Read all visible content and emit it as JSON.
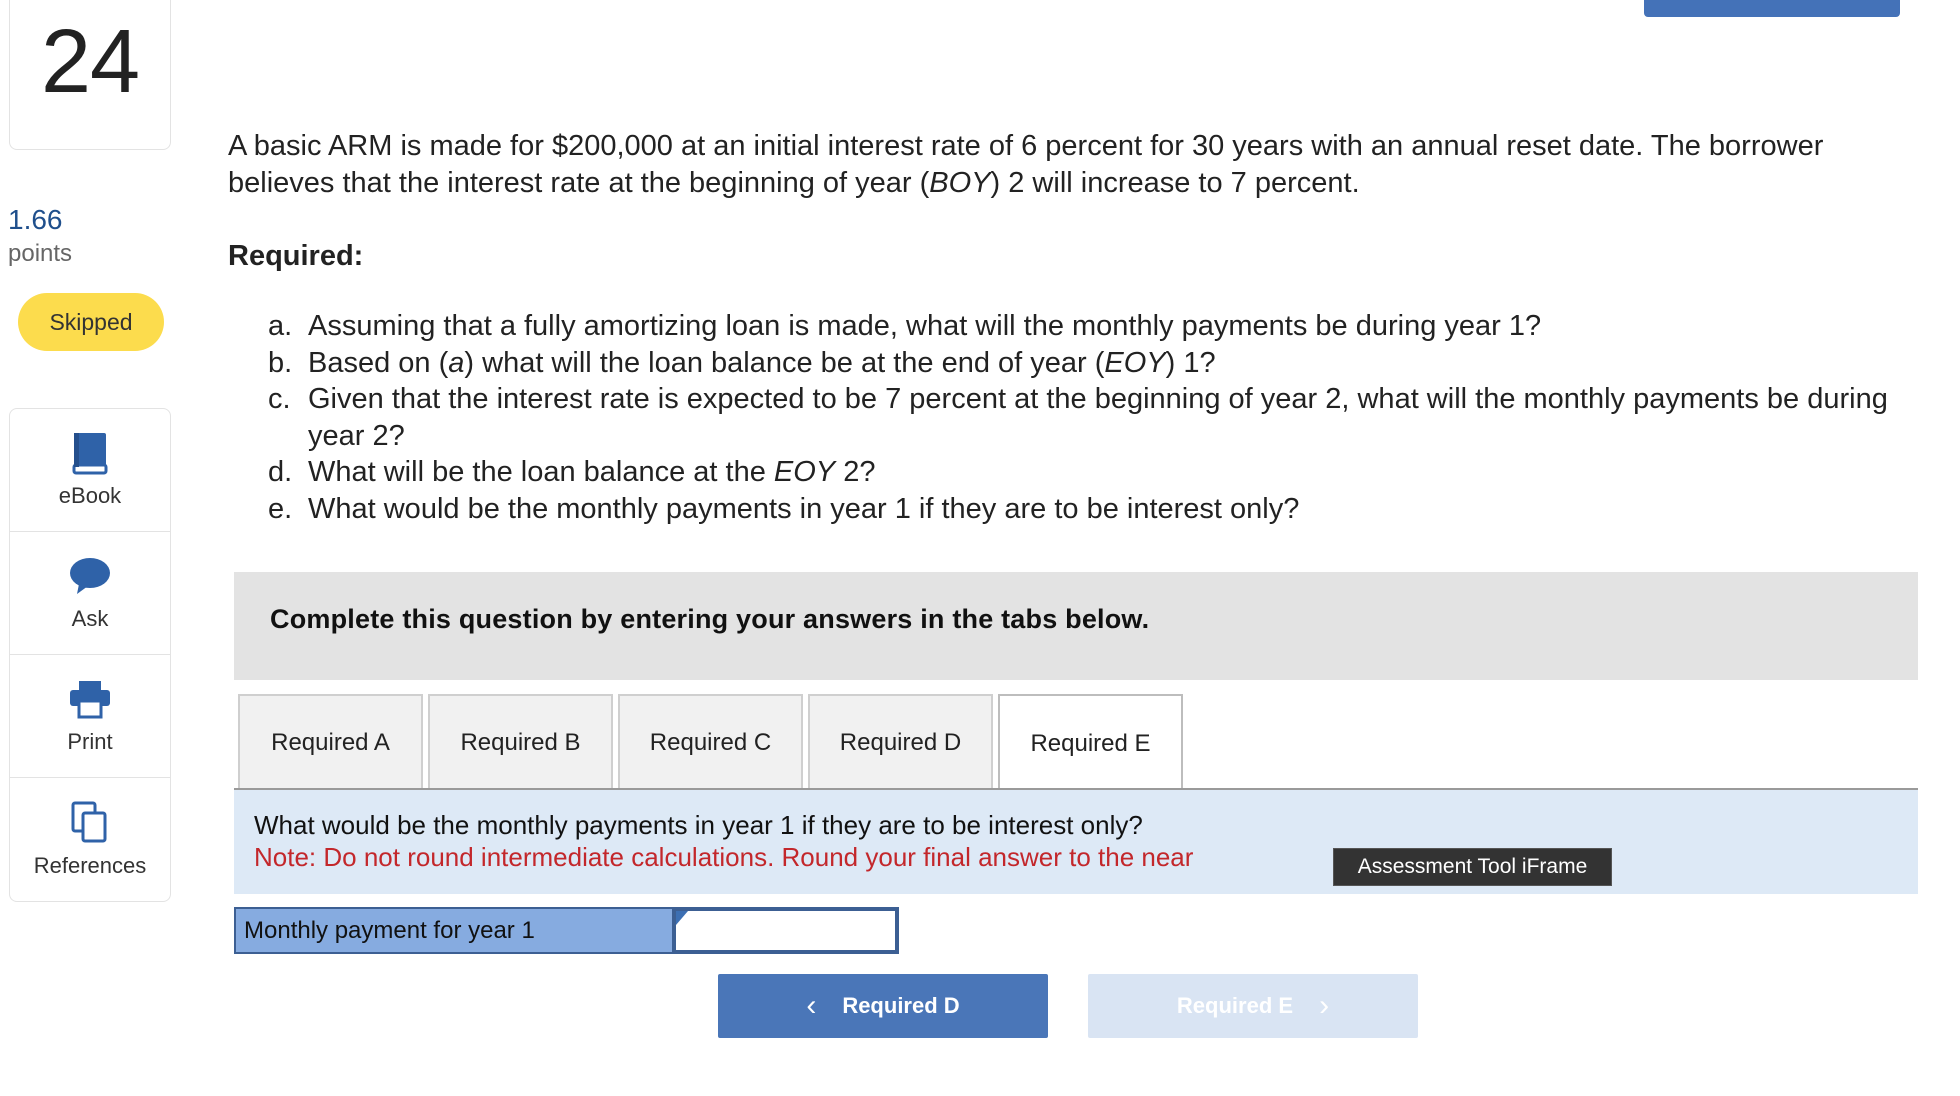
{
  "question": {
    "number": "24",
    "points_value": "1.66",
    "points_label": "points",
    "status": "Skipped"
  },
  "tools": [
    {
      "label": "eBook",
      "icon": "book-icon"
    },
    {
      "label": "Ask",
      "icon": "chat-bubble-icon"
    },
    {
      "label": "Print",
      "icon": "printer-icon"
    },
    {
      "label": "References",
      "icon": "copy-documents-icon"
    }
  ],
  "prompt": {
    "intro_1": "A basic ARM is made for $200,000 at an initial interest rate of 6 percent for 30 years with an annual reset date. The borrower believes that the interest rate at the beginning of year (",
    "intro_boy": "BOY",
    "intro_2": ") 2 will increase to 7 percent.",
    "required_heading": "Required:",
    "parts": {
      "a_label": "a.",
      "a_text": "Assuming that a fully amortizing loan is made, what will the monthly payments be during year 1?",
      "b_label": "b.",
      "b_text_1": "Based on (",
      "b_text_a": "a",
      "b_text_2": ") what will the loan balance be at the end of year (",
      "b_text_eoy": "EOY",
      "b_text_3": ") 1?",
      "c_label": "c.",
      "c_text": "Given that the interest rate is expected to be 7 percent at the beginning of year 2, what will the monthly payments be during year 2?",
      "d_label": "d.",
      "d_text_1": "What will be the loan balance at the ",
      "d_text_eoy": "EOY",
      "d_text_2": " 2?",
      "e_label": "e.",
      "e_text": "What would be the monthly payments in year 1 if they are to be interest only?"
    }
  },
  "banner": {
    "text": "Complete this question by entering your answers in the tabs below."
  },
  "tabs": [
    {
      "label": "Required A",
      "active": false
    },
    {
      "label": "Required B",
      "active": false
    },
    {
      "label": "Required C",
      "active": false
    },
    {
      "label": "Required D",
      "active": false
    },
    {
      "label": "Required E",
      "active": true
    }
  ],
  "panel": {
    "question": "What would be the monthly payments in year 1 if they are to be interest only?",
    "note": "Note: Do not round intermediate calculations. Round your final answer to the near"
  },
  "tooltip": {
    "text": "Assessment Tool iFrame"
  },
  "answer": {
    "label": "Monthly payment for year 1",
    "value": ""
  },
  "nav": {
    "prev_label": "Required D",
    "next_label": "Required E"
  },
  "colors": {
    "accent": "#4a76b8",
    "skipped_badge": "#fcdc4d",
    "note_red": "#c3272b",
    "panel_bg": "#dde9f6",
    "answer_label_bg": "#86abe0"
  }
}
